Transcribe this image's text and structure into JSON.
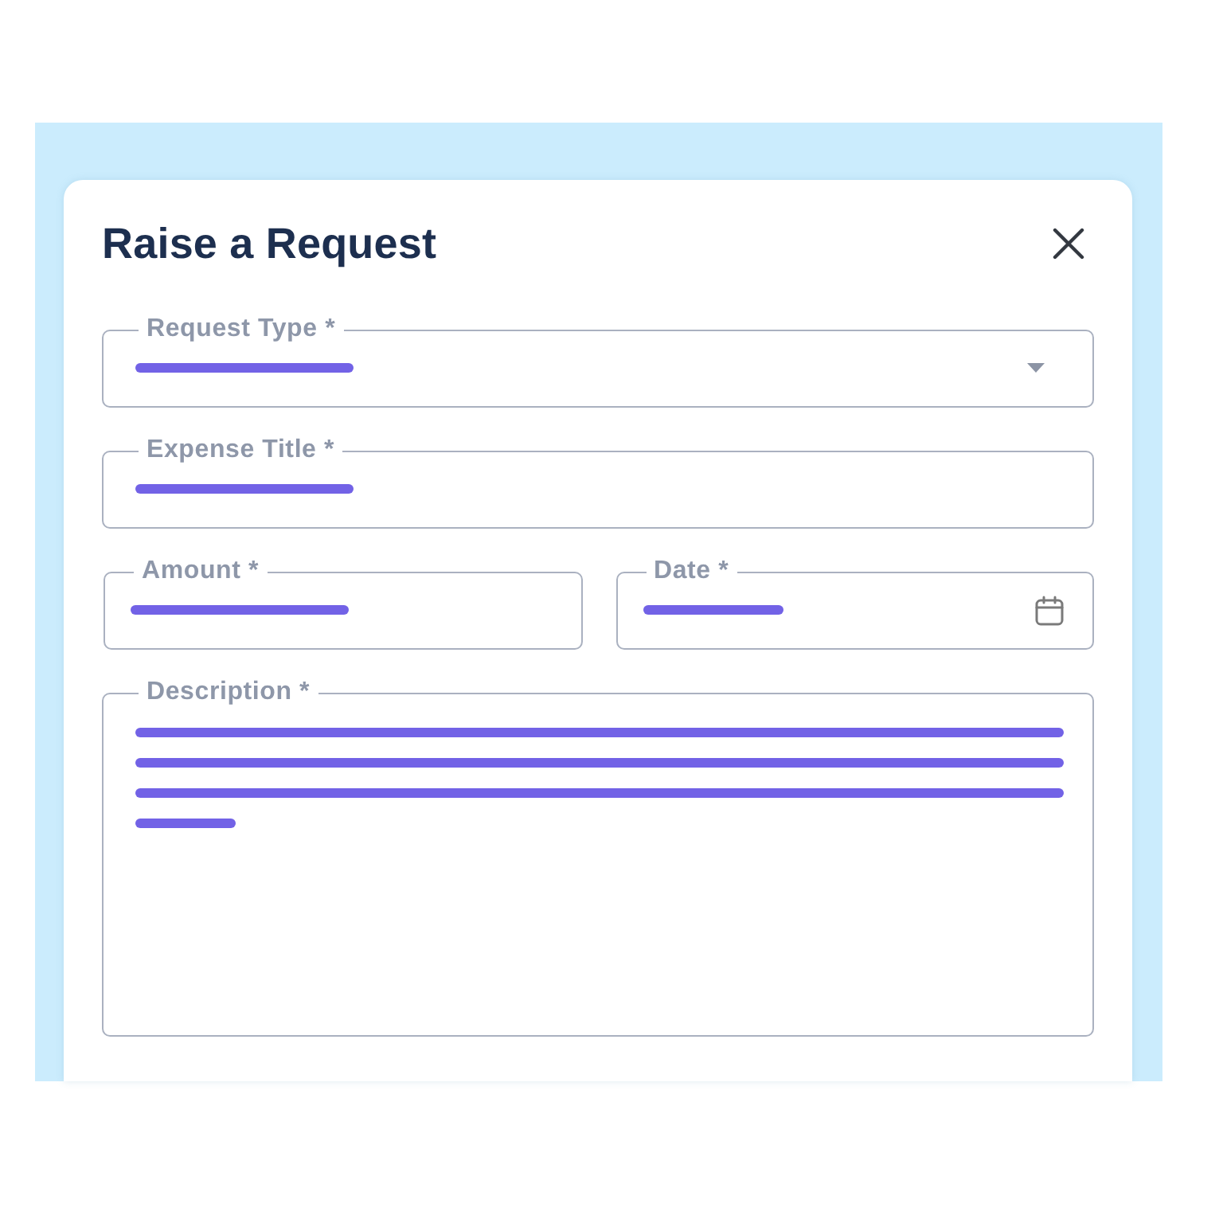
{
  "dialog": {
    "title": "Raise a Request"
  },
  "rows": [
    {
      "fields": [
        {
          "label": "Request Type *",
          "kind": "select",
          "filled": true
        }
      ]
    },
    {
      "fields": [
        {
          "label": "Expense Title *",
          "kind": "text",
          "filled": true
        }
      ]
    },
    {
      "fields": [
        {
          "label": "Amount *",
          "kind": "text",
          "filled": true
        },
        {
          "label": "Date *",
          "kind": "date",
          "filled": true
        }
      ]
    },
    {
      "fields": [
        {
          "label": "Description *",
          "kind": "textarea",
          "filled": true
        }
      ]
    }
  ]
}
